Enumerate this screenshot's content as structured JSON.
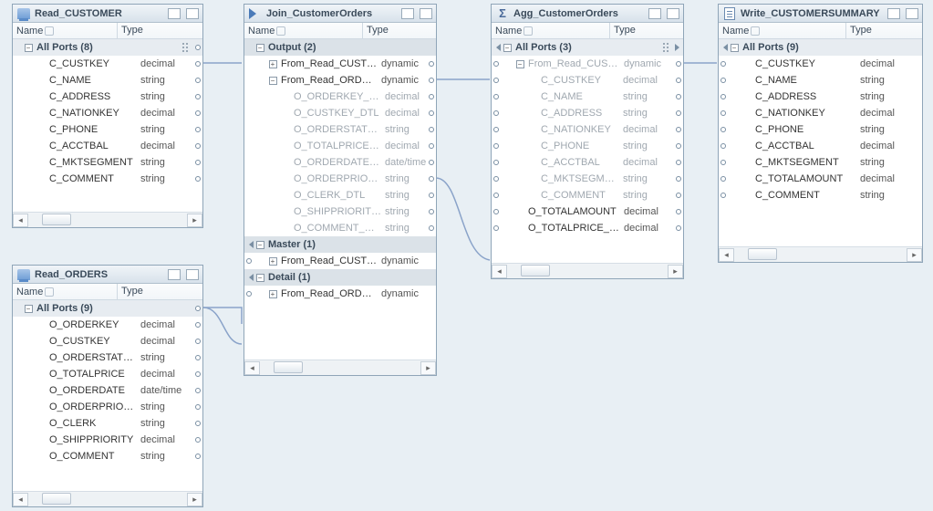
{
  "col_name": "Name",
  "col_type": "Type",
  "nodes": {
    "readCustomer": {
      "title": "Read_CUSTOMER",
      "group": "All Ports (8)",
      "rows": [
        {
          "name": "C_CUSTKEY",
          "type": "decimal"
        },
        {
          "name": "C_NAME",
          "type": "string"
        },
        {
          "name": "C_ADDRESS",
          "type": "string"
        },
        {
          "name": "C_NATIONKEY",
          "type": "decimal"
        },
        {
          "name": "C_PHONE",
          "type": "string"
        },
        {
          "name": "C_ACCTBAL",
          "type": "decimal"
        },
        {
          "name": "C_MKTSEGMENT",
          "type": "string"
        },
        {
          "name": "C_COMMENT",
          "type": "string"
        }
      ]
    },
    "readOrders": {
      "title": "Read_ORDERS",
      "group": "All Ports (9)",
      "rows": [
        {
          "name": "O_ORDERKEY",
          "type": "decimal"
        },
        {
          "name": "O_CUSTKEY",
          "type": "decimal"
        },
        {
          "name": "O_ORDERSTATUS",
          "type": "string"
        },
        {
          "name": "O_TOTALPRICE",
          "type": "decimal"
        },
        {
          "name": "O_ORDERDATE",
          "type": "date/time"
        },
        {
          "name": "O_ORDERPRIORI...",
          "type": "string"
        },
        {
          "name": "O_CLERK",
          "type": "string"
        },
        {
          "name": "O_SHIPPRIORITY",
          "type": "decimal"
        },
        {
          "name": "O_COMMENT",
          "type": "string"
        }
      ]
    },
    "join": {
      "title": "Join_CustomerOrders",
      "groups": {
        "output": "Output (2)",
        "fromCust": "From_Read_CUSTO...",
        "fromOrders": "From_Read_ORDERS",
        "master": "Master (1)",
        "masterFrom": "From_Read_CUSTO...",
        "detail": "Detail (1)",
        "detailFrom": "From_Read_ORDERS"
      },
      "types": {
        "dynamic": "dynamic"
      },
      "rows": [
        {
          "name": "O_ORDERKEY_DTL",
          "type": "decimal"
        },
        {
          "name": "O_CUSTKEY_DTL",
          "type": "decimal"
        },
        {
          "name": "O_ORDERSTATUS...",
          "type": "string"
        },
        {
          "name": "O_TOTALPRICE_DTL",
          "type": "decimal"
        },
        {
          "name": "O_ORDERDATE_DTL",
          "type": "date/time"
        },
        {
          "name": "O_ORDERPRIORIT...",
          "type": "string"
        },
        {
          "name": "O_CLERK_DTL",
          "type": "string"
        },
        {
          "name": "O_SHIPPRIORITY_...",
          "type": "string"
        },
        {
          "name": "O_COMMENT_DTL",
          "type": "string"
        }
      ]
    },
    "agg": {
      "title": "Agg_CustomerOrders",
      "group": "All Ports (3)",
      "fromCust": "From_Read_CUST...",
      "types": {
        "dynamic": "dynamic"
      },
      "dimRows": [
        {
          "name": "C_CUSTKEY",
          "type": "decimal"
        },
        {
          "name": "C_NAME",
          "type": "string"
        },
        {
          "name": "C_ADDRESS",
          "type": "string"
        },
        {
          "name": "C_NATIONKEY",
          "type": "decimal"
        },
        {
          "name": "C_PHONE",
          "type": "string"
        },
        {
          "name": "C_ACCTBAL",
          "type": "decimal"
        },
        {
          "name": "C_MKTSEGMENT",
          "type": "string"
        },
        {
          "name": "C_COMMENT",
          "type": "string"
        }
      ],
      "rows": [
        {
          "name": "O_TOTALAMOUNT",
          "type": "decimal"
        },
        {
          "name": "O_TOTALPRICE_DTL",
          "type": "decimal"
        }
      ]
    },
    "write": {
      "title": "Write_CUSTOMERSUMMARY",
      "group": "All Ports (9)",
      "rows": [
        {
          "name": "C_CUSTKEY",
          "type": "decimal"
        },
        {
          "name": "C_NAME",
          "type": "string"
        },
        {
          "name": "C_ADDRESS",
          "type": "string"
        },
        {
          "name": "C_NATIONKEY",
          "type": "decimal"
        },
        {
          "name": "C_PHONE",
          "type": "string"
        },
        {
          "name": "C_ACCTBAL",
          "type": "decimal"
        },
        {
          "name": "C_MKTSEGMENT",
          "type": "string"
        },
        {
          "name": "C_TOTALAMOUNT",
          "type": "decimal"
        },
        {
          "name": "C_COMMENT",
          "type": "string"
        }
      ]
    }
  }
}
